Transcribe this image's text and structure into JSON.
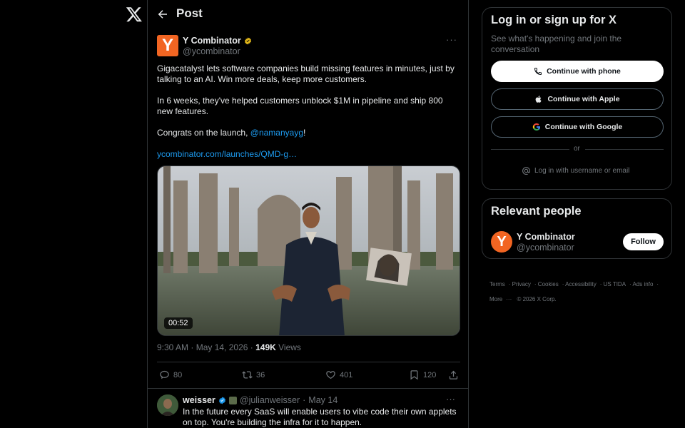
{
  "post": {
    "header_title": "Post",
    "author_name": "Y Combinator",
    "author_handle": "@ycombinator",
    "avatar_letter": "Y",
    "text_p1": "Gigacatalyst lets software companies build missing features in minutes, just by talking to an AI. Win more deals, keep more customers.",
    "text_p2": "In 6 weeks, they've helped customers unblock $1M in pipeline and ship 800 new features.",
    "text_p3_prefix": "Congrats on the launch, ",
    "text_p3_mention": "@namanyayg",
    "text_p3_suffix": "!",
    "link": "ycombinator.com/launches/QMD-g…",
    "video_duration": "00:52",
    "time": "9:30 AM",
    "date": "May 14, 2026",
    "views_count": "149K",
    "views_label": "Views",
    "replies": "80",
    "reposts": "36",
    "likes": "401",
    "bookmarks": "120"
  },
  "reply": {
    "name": "weisser",
    "handle": "@julianweisser",
    "date": "May 14",
    "text": "In the future every SaaS will enable users to vibe code their own applets on top. You're building the infra for it to happen."
  },
  "login": {
    "title": "Log in or sign up for X",
    "subtitle": "See what's happening and join the conversation",
    "phone": "Continue with phone",
    "apple": "Continue with Apple",
    "google": "Continue with Google",
    "or": "or",
    "username": "Log in with username or email"
  },
  "people": {
    "title": "Relevant people",
    "name": "Y Combinator",
    "handle": "@ycombinator",
    "follow": "Follow",
    "avatar_letter": "Y"
  },
  "footer": {
    "terms": "Terms",
    "privacy": "Privacy",
    "cookies": "Cookies",
    "accessibility": "Accessibility",
    "ustida": "US TIDA",
    "adsinfo": "Ads info",
    "more": "More",
    "copyright": "© 2026 X Corp."
  },
  "colors": {
    "accent": "#1d9bf0",
    "background": "#000000",
    "yc_orange": "#f26522"
  }
}
